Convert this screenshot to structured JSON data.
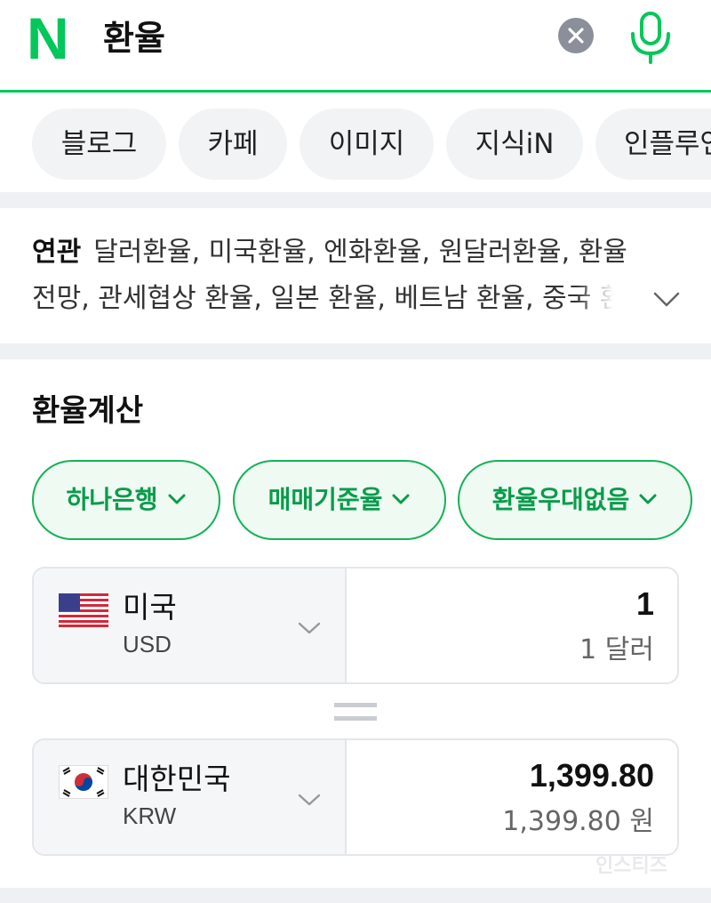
{
  "search": {
    "logo": "N",
    "query": "환율"
  },
  "tabs": [
    {
      "label": "블로그"
    },
    {
      "label": "카페"
    },
    {
      "label": "이미지"
    },
    {
      "label": "지식iN"
    },
    {
      "label": "인플루언"
    }
  ],
  "related": {
    "label": "연관",
    "line1": "달러환율, 미국환율, 엔화환율, 원달러환율, 환율",
    "line2": "전망, 관세협상 환율, 일본 환율, 베트남 환율, 중국 환"
  },
  "calculator": {
    "title": "환율계산",
    "filters": [
      {
        "label": "하나은행"
      },
      {
        "label": "매매기준율"
      },
      {
        "label": "환율우대없음"
      }
    ],
    "from": {
      "country": "미국",
      "code": "USD",
      "amount": "1",
      "amount_text": "1 달러",
      "flag_icon": "us-flag-icon"
    },
    "to": {
      "country": "대한민국",
      "code": "KRW",
      "amount": "1,399.80",
      "amount_text": "1,399.80 원",
      "flag_icon": "kr-flag-icon"
    }
  },
  "watermark": "인스티즈",
  "colors": {
    "brand_green": "#03c75a",
    "filter_green": "#14b257",
    "tab_bg": "#f2f3f5",
    "divider": "#eef0f3"
  }
}
